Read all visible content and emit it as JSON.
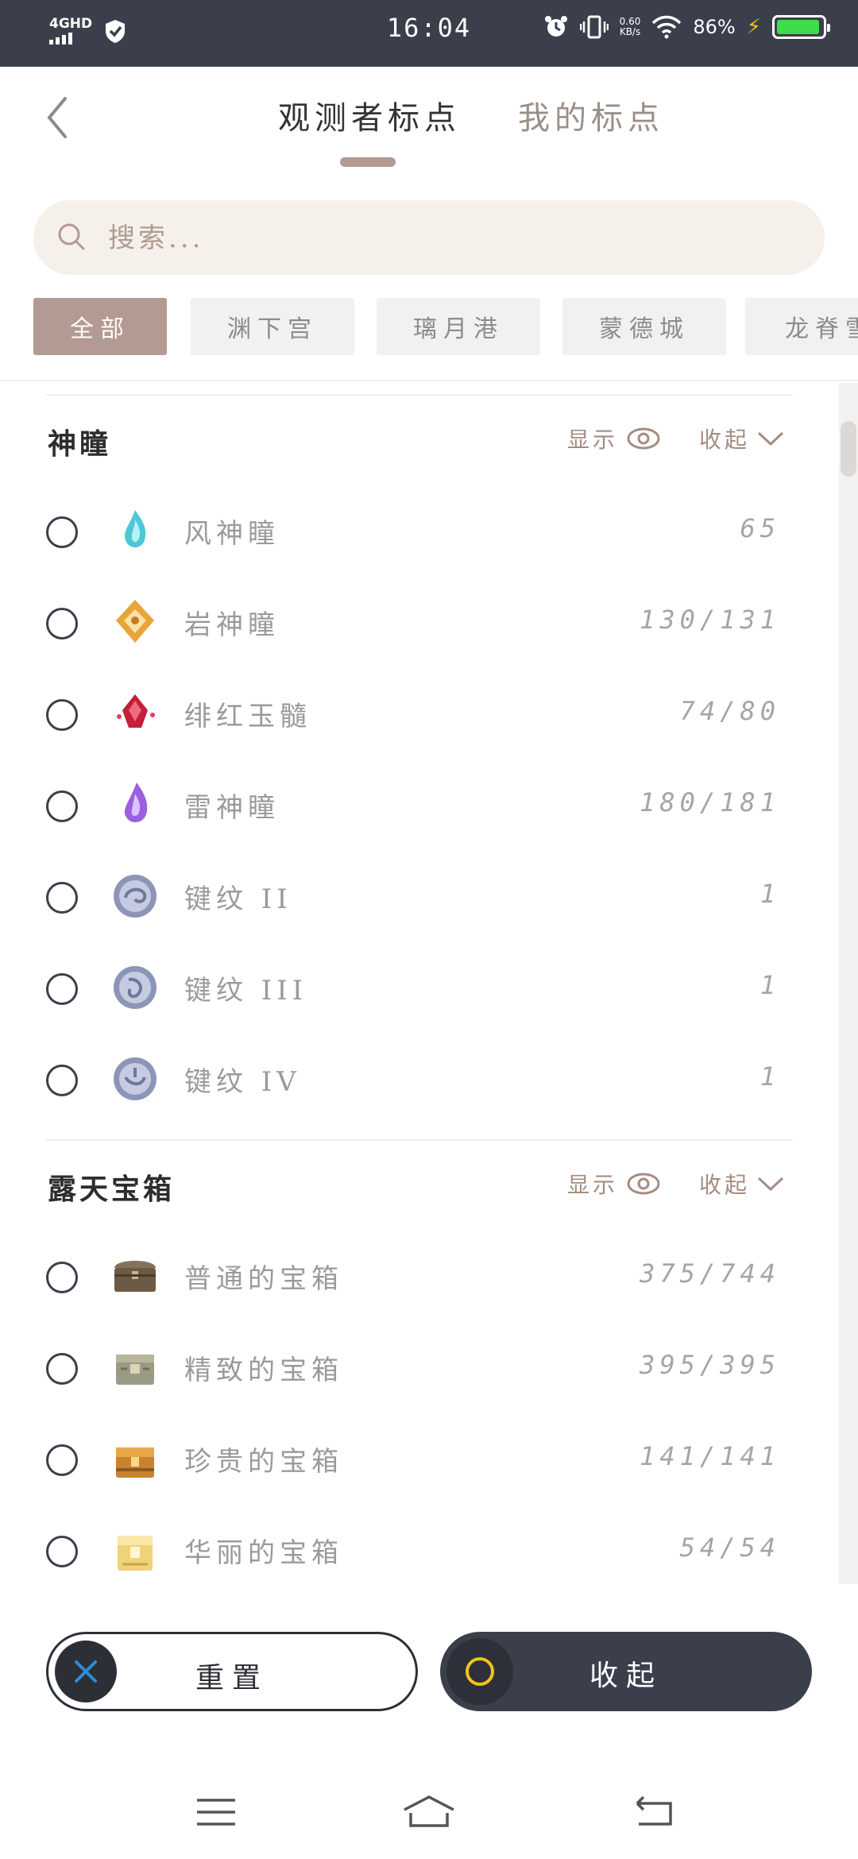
{
  "status_bar": {
    "network": "4GHD",
    "time": "16:04",
    "speed_top": "0.60",
    "speed_bottom": "KB/s",
    "battery": "86%",
    "battery_level": 0.86
  },
  "header": {
    "tabs": [
      "观测者标点",
      "我的标点"
    ],
    "active_tab": 0
  },
  "search": {
    "placeholder": "搜索..."
  },
  "filters": [
    "全部",
    "渊下宫",
    "璃月港",
    "蒙德城",
    "龙脊雪山"
  ],
  "sections": [
    {
      "title": "神瞳",
      "show_label": "显示",
      "collapse_label": "收起",
      "items": [
        {
          "label": "风神瞳",
          "count": "65",
          "icon": "anemoculus-icon"
        },
        {
          "label": "岩神瞳",
          "count": "130/131",
          "icon": "geoculus-icon"
        },
        {
          "label": "绯红玉髓",
          "count": "74/80",
          "icon": "crimson-agate-icon"
        },
        {
          "label": "雷神瞳",
          "count": "180/181",
          "icon": "electroculus-icon"
        },
        {
          "label": "键纹 II",
          "count": "1",
          "icon": "key-sigil-icon"
        },
        {
          "label": "键纹 III",
          "count": "1",
          "icon": "key-sigil-icon"
        },
        {
          "label": "键纹 IV",
          "count": "1",
          "icon": "key-sigil-icon"
        }
      ]
    },
    {
      "title": "露天宝箱",
      "show_label": "显示",
      "collapse_label": "收起",
      "items": [
        {
          "label": "普通的宝箱",
          "count": "375/744",
          "icon": "common-chest-icon"
        },
        {
          "label": "精致的宝箱",
          "count": "395/395",
          "icon": "exquisite-chest-icon"
        },
        {
          "label": "珍贵的宝箱",
          "count": "141/141",
          "icon": "precious-chest-icon"
        },
        {
          "label": "华丽的宝箱",
          "count": "54/54",
          "icon": "luxurious-chest-icon"
        }
      ]
    }
  ],
  "buttons": {
    "reset": "重置",
    "collapse": "收起"
  },
  "colors": {
    "accent": "#b39a92",
    "dark": "#3a3f4b",
    "reset_x": "#2f8bd6",
    "collapse_ring": "#f0c419"
  }
}
